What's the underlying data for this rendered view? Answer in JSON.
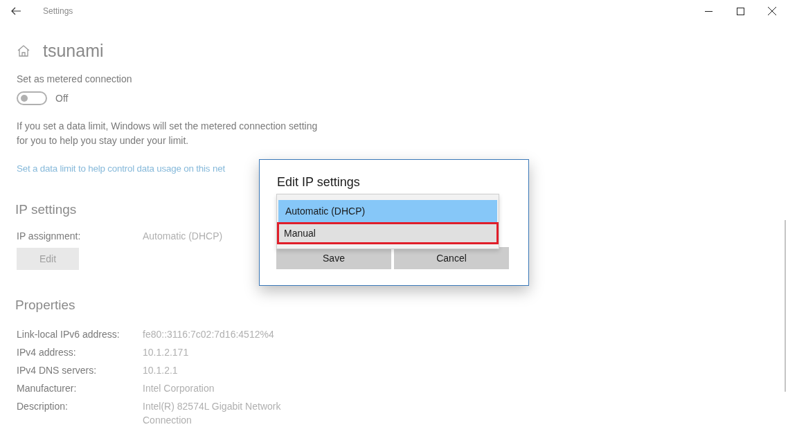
{
  "window": {
    "title": "Settings"
  },
  "page": {
    "title": "tsunami"
  },
  "metered": {
    "label": "Set as metered connection",
    "on": false,
    "state_text": "Off",
    "description": "If you set a data limit, Windows will set the metered connection setting for you to help you stay under your limit.",
    "link": "Set a data limit to help control data usage on this net"
  },
  "ip_settings": {
    "heading": "IP settings",
    "label": "IP assignment:",
    "value": "Automatic (DHCP)",
    "button": "Edit"
  },
  "properties": {
    "heading": "Properties",
    "rows": [
      {
        "label": "Link-local IPv6 address:",
        "value": "fe80::3116:7c02:7d16:4512%4"
      },
      {
        "label": "IPv4 address:",
        "value": "10.1.2.171"
      },
      {
        "label": "IPv4 DNS servers:",
        "value": "10.1.2.1"
      },
      {
        "label": "Manufacturer:",
        "value": "Intel Corporation"
      },
      {
        "label": "Description:",
        "value": "Intel(R) 82574L Gigabit Network Connection"
      }
    ]
  },
  "dialog": {
    "title": "Edit IP settings",
    "options": [
      {
        "label": "Automatic (DHCP)",
        "selected": true,
        "highlighted": false
      },
      {
        "label": "Manual",
        "selected": false,
        "highlighted": true
      }
    ],
    "buttons": [
      "Save",
      "Cancel"
    ]
  }
}
